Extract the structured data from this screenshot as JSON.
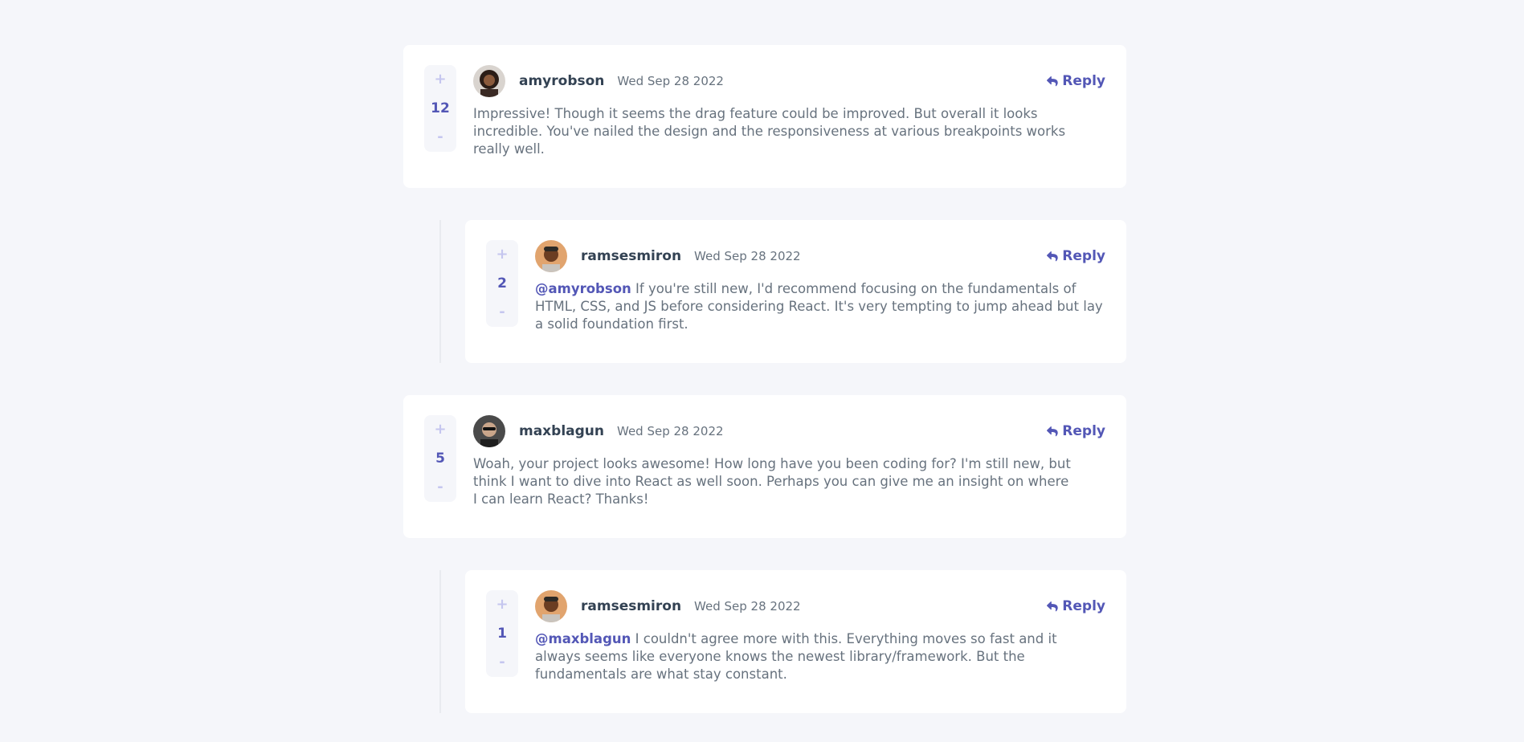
{
  "comments": [
    {
      "score": "12",
      "username": "amyrobson",
      "date": "Wed Sep 28 2022",
      "reply_label": "Reply",
      "mention": "",
      "content": "Impressive! Though it seems the drag feature could be improved. But overall it looks incredible. You've nailed the design and the responsiveness at various breakpoints works really well."
    },
    {
      "score": "2",
      "username": "ramsesmiron",
      "date": "Wed Sep 28 2022",
      "reply_label": "Reply",
      "mention": "@amyrobson",
      "content": "If you're still new, I'd recommend focusing on the fundamentals of HTML, CSS, and JS before considering React. It's very tempting to jump ahead but lay a solid foundation first."
    },
    {
      "score": "5",
      "username": "maxblagun",
      "date": "Wed Sep 28 2022",
      "reply_label": "Reply",
      "mention": "",
      "content": "Woah, your project looks awesome! How long have you been coding for? I'm still new, but think I want to dive into React as well soon. Perhaps you can give me an insight on where I can learn React? Thanks!"
    },
    {
      "score": "1",
      "username": "ramsesmiron",
      "date": "Wed Sep 28 2022",
      "reply_label": "Reply",
      "mention": "@maxblagun",
      "content": "I couldn't agree more with this. Everything moves so fast and it always seems like everyone knows the newest library/framework. But the fundamentals are what stay constant."
    }
  ],
  "vote": {
    "plus": "+",
    "minus": "-"
  },
  "colors": {
    "background": "#f5f6fa",
    "accent": "#5357b6",
    "vote_light": "#c5c6ef",
    "username": "#334253",
    "text": "#67727e"
  }
}
